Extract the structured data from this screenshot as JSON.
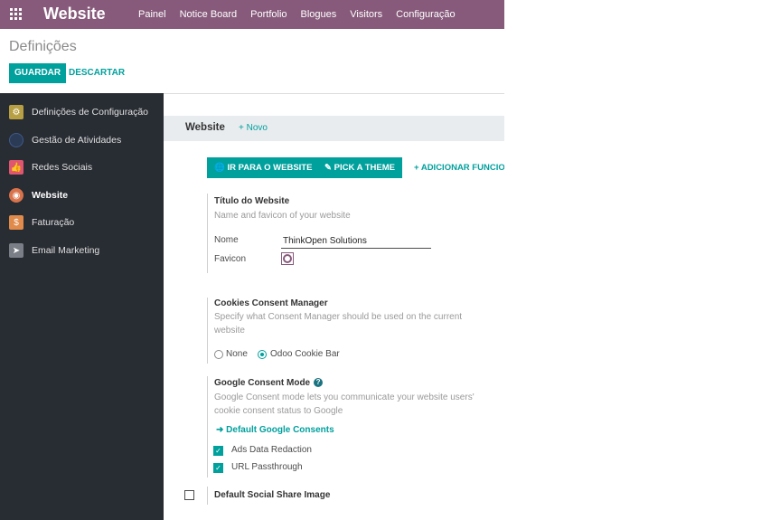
{
  "navbar": {
    "brand": "Website",
    "menu": [
      "Painel",
      "Notice Board",
      "Portfolio",
      "Blogues",
      "Visitors",
      "Configuração"
    ]
  },
  "control": {
    "breadcrumb": "Definições",
    "save_label": "GUARDAR",
    "discard_label": "DESCARTAR"
  },
  "sidebar": {
    "items": [
      {
        "label": "Definições de Configuração",
        "icon": "gear-icon",
        "color": "#b7a043"
      },
      {
        "label": "Gestão de Atividades",
        "icon": "activity-icon",
        "color": "#2b3a55"
      },
      {
        "label": "Redes Sociais",
        "icon": "thumbs-up-icon",
        "color": "#e0556f"
      },
      {
        "label": "Website",
        "icon": "globe-icon",
        "color": "#d9734b"
      },
      {
        "label": "Faturação",
        "icon": "invoice-icon",
        "color": "#e08a4b"
      },
      {
        "label": "Email Marketing",
        "icon": "paper-plane-icon",
        "color": "#7a7f87"
      }
    ],
    "active": "Website"
  },
  "main": {
    "section_title": "Website",
    "section_new": "+ Novo",
    "buttons": {
      "go_website": "IR PARA O WEBSITE",
      "pick_theme": "PICK A THEME",
      "add_feature": "+ ADICIONAR FUNCIO"
    },
    "website_title": {
      "title": "Título do Website",
      "description": "Name and favicon of your website",
      "name_label": "Nome",
      "name_value": "ThinkOpen Solutions",
      "favicon_label": "Favicon"
    },
    "cookies": {
      "title": "Cookies Consent Manager",
      "description": "Specify what Consent Manager should be used on the current website",
      "options": [
        "None",
        "Odoo Cookie Bar"
      ],
      "selected": "Odoo Cookie Bar"
    },
    "google_consent": {
      "title": "Google Consent Mode",
      "help": "?",
      "description": "Google Consent mode lets you communicate your website users' cookie consent status to Google",
      "link": "Default Google Consents",
      "checks": [
        {
          "label": "Ads Data Redaction",
          "checked": true
        },
        {
          "label": "URL Passthrough",
          "checked": true
        }
      ]
    },
    "social_share": {
      "title": "Default Social Share Image",
      "checked": false
    }
  },
  "colors": {
    "navbar": "#875a7b",
    "accent": "#00a09d",
    "sidebar": "#282c33"
  }
}
